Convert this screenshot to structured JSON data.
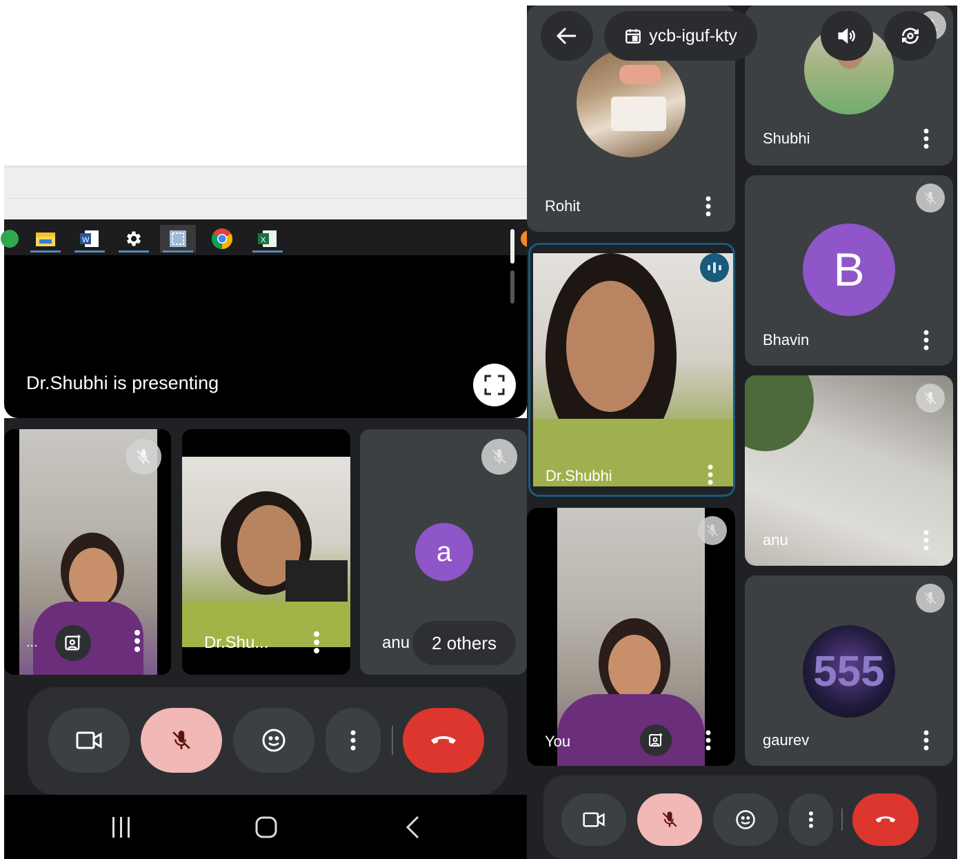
{
  "left": {
    "presenting_text": "Dr.Shubhi is presenting",
    "tiles": [
      {
        "name": "...",
        "muted": true
      },
      {
        "name": "Dr.Shu...",
        "muted": false
      },
      {
        "name": "anu",
        "avatar_letter": "a",
        "others_label": "2 others",
        "muted": true
      }
    ],
    "taskbar_icons": [
      "file-explorer-icon",
      "word-icon",
      "settings-icon",
      "snipping-icon",
      "chrome-icon",
      "excel-icon"
    ]
  },
  "right": {
    "meeting_code": "ycb-iguf-kty",
    "tiles": [
      {
        "name": "Rohit",
        "muted": false
      },
      {
        "name": "Shubhi",
        "muted": true
      },
      {
        "name": "Dr.Shubhi",
        "speaking": true
      },
      {
        "name": "Bhavin",
        "avatar_letter": "B",
        "muted": true
      },
      {
        "name": "You",
        "muted": true
      },
      {
        "name": "anu",
        "muted": true
      },
      {
        "name": "gaurev",
        "avatar_text": "555",
        "muted": true
      }
    ]
  },
  "colors": {
    "background": "#202124",
    "tile": "#3c4043",
    "mute_active": "#f2b8b5",
    "end_call": "#dc362e",
    "avatar_purple": "#8e56c9",
    "speaking_blue": "#1a5a7a"
  }
}
